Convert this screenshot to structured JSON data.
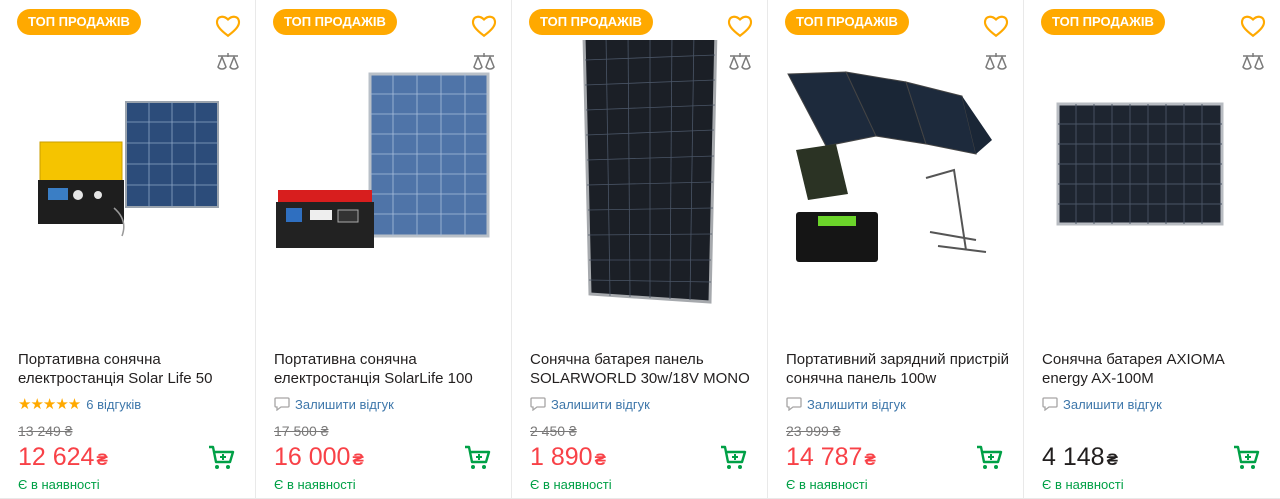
{
  "colors": {
    "badge": "#ffa900",
    "accent_green": "#00a046",
    "sale_price": "#f84147",
    "link": "#3e77aa"
  },
  "icons": {
    "favorite": "heart-icon",
    "compare": "scales-icon",
    "cart": "cart-icon",
    "review": "comment-icon",
    "rating": "star-icon"
  },
  "products": [
    {
      "badge": "ТОП ПРОДАЖІВ",
      "title": "Портативна сонячна електростанція Solar Life 50",
      "rating_stars": 5,
      "stars_text": "★★★★★",
      "reviews": "6 відгуків",
      "old_price": "13 249 ₴",
      "price": "12 624",
      "currency": "₴",
      "stock": "Є в наявності"
    },
    {
      "badge": "ТОП ПРОДАЖІВ",
      "title": "Портативна сонячна електростанція SolarLife 100",
      "review_link": "Залишити відгук",
      "old_price": "17 500 ₴",
      "price": "16 000",
      "currency": "₴",
      "stock": "Є в наявності"
    },
    {
      "badge": "ТОП ПРОДАЖІВ",
      "title": "Сонячна батарея панель SOLARWORLD 30w/18V MONO",
      "review_link": "Залишити відгук",
      "old_price": "2 450 ₴",
      "price": "1 890",
      "currency": "₴",
      "stock": "Є в наявності"
    },
    {
      "badge": "ТОП ПРОДАЖІВ",
      "title": "Портативний зарядний пристрій сонячна панель 100w",
      "review_link": "Залишити відгук",
      "old_price": "23 999 ₴",
      "price": "14 787",
      "currency": "₴",
      "stock": "Є в наявності"
    },
    {
      "badge": "ТОП ПРОДАЖІВ",
      "title": "Сонячна батарея AXIOMA energy AX-100M",
      "review_link": "Залишити відгук",
      "price": "4 148",
      "currency": "₴",
      "stock": "Є в наявності"
    }
  ]
}
